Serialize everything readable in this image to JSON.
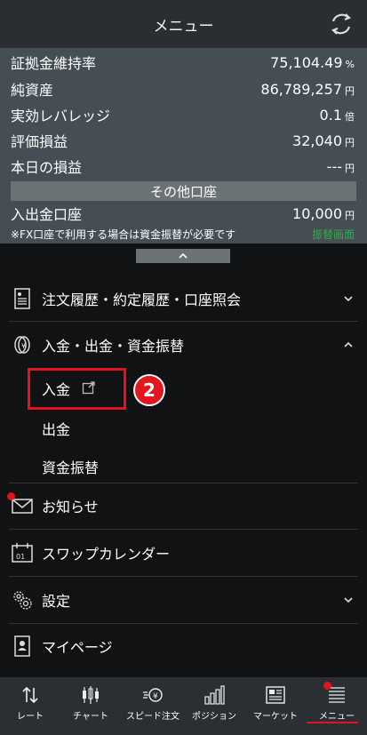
{
  "header": {
    "title": "メニュー"
  },
  "summary": {
    "rows": [
      {
        "label": "証拠金維持率",
        "value": "75,104.49",
        "unit": "%"
      },
      {
        "label": "純資産",
        "value": "86,789,257",
        "unit": "円"
      },
      {
        "label": "実効レバレッジ",
        "value": "0.1",
        "unit": "倍"
      },
      {
        "label": "評価損益",
        "value": "32,040",
        "unit": "円"
      },
      {
        "label": "本日の損益",
        "value": "---",
        "unit": "円"
      }
    ],
    "other_section": "その他口座",
    "deposit_account": {
      "label": "入出金口座",
      "value": "10,000",
      "unit": "円"
    },
    "note": "※FX口座で利用する場合は資金振替が必要です",
    "note_link": "振替画面"
  },
  "menu": {
    "history": "注文履歴・約定履歴・口座照会",
    "funds": "入金・出金・資金振替",
    "funds_sub": {
      "deposit": "入金",
      "withdraw": "出金",
      "transfer": "資金振替"
    },
    "news": "お知らせ",
    "swap": "スワップカレンダー",
    "settings": "設定",
    "mypage": "マイページ"
  },
  "step_badge": "2",
  "tabs": [
    "レート",
    "チャート",
    "スピード注文",
    "ポジション",
    "マーケット",
    "メニュー"
  ],
  "colors": {
    "accent_red": "#e0141f",
    "link_green": "#2fae47",
    "summary_bg": "#454e54"
  }
}
